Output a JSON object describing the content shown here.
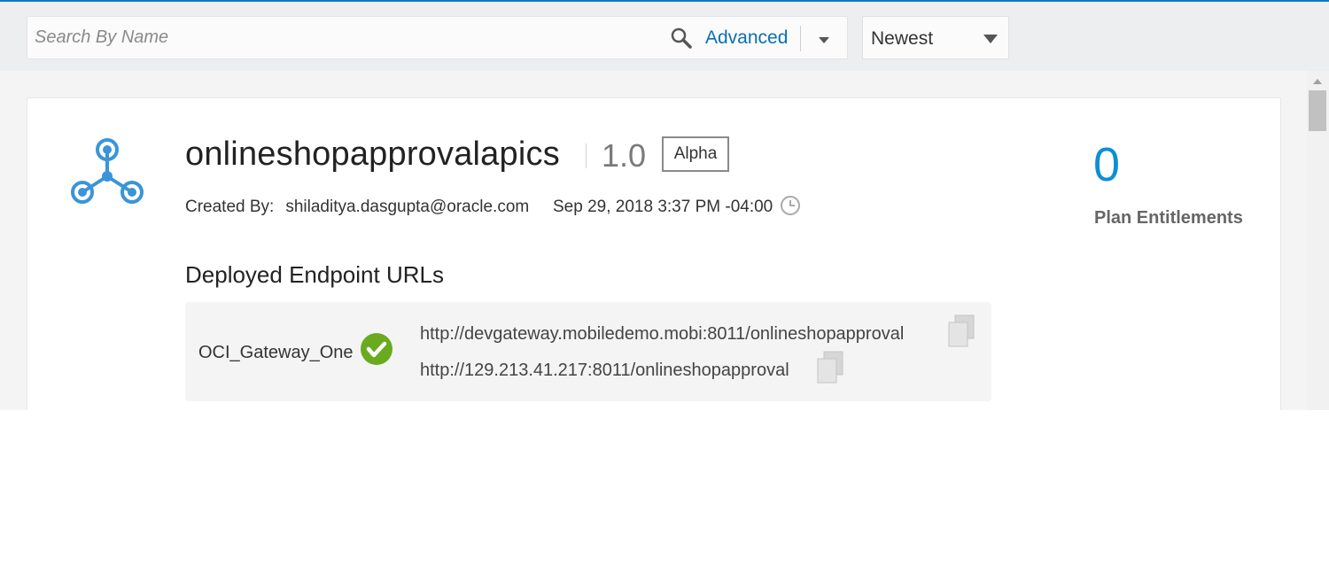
{
  "search": {
    "placeholder": "Search By Name",
    "advanced_label": "Advanced"
  },
  "sort": {
    "selected": "Newest"
  },
  "api": {
    "name": "onlineshopapprovalapics",
    "version": "1.0",
    "state_badge": "Alpha",
    "created_by_label": "Created By:",
    "created_by": "shiladitya.dasgupta@oracle.com",
    "created_date": "Sep 29, 2018 3:37 PM -04:00",
    "plan_entitlements_count": "0",
    "plan_entitlements_label": "Plan Entitlements"
  },
  "endpoints": {
    "section_title": "Deployed Endpoint URLs",
    "gateway": {
      "name": "OCI_Gateway_One",
      "status": "deployed",
      "urls": [
        "http://devgateway.mobiledemo.mobi:8011/onlineshopapproval",
        "http://129.213.41.217:8011/onlineshopapproval"
      ]
    }
  },
  "colors": {
    "accent": "#0b8fd6",
    "link": "#0a6fb5",
    "success": "#6aaa1e",
    "api_icon": "#3a95d8"
  }
}
